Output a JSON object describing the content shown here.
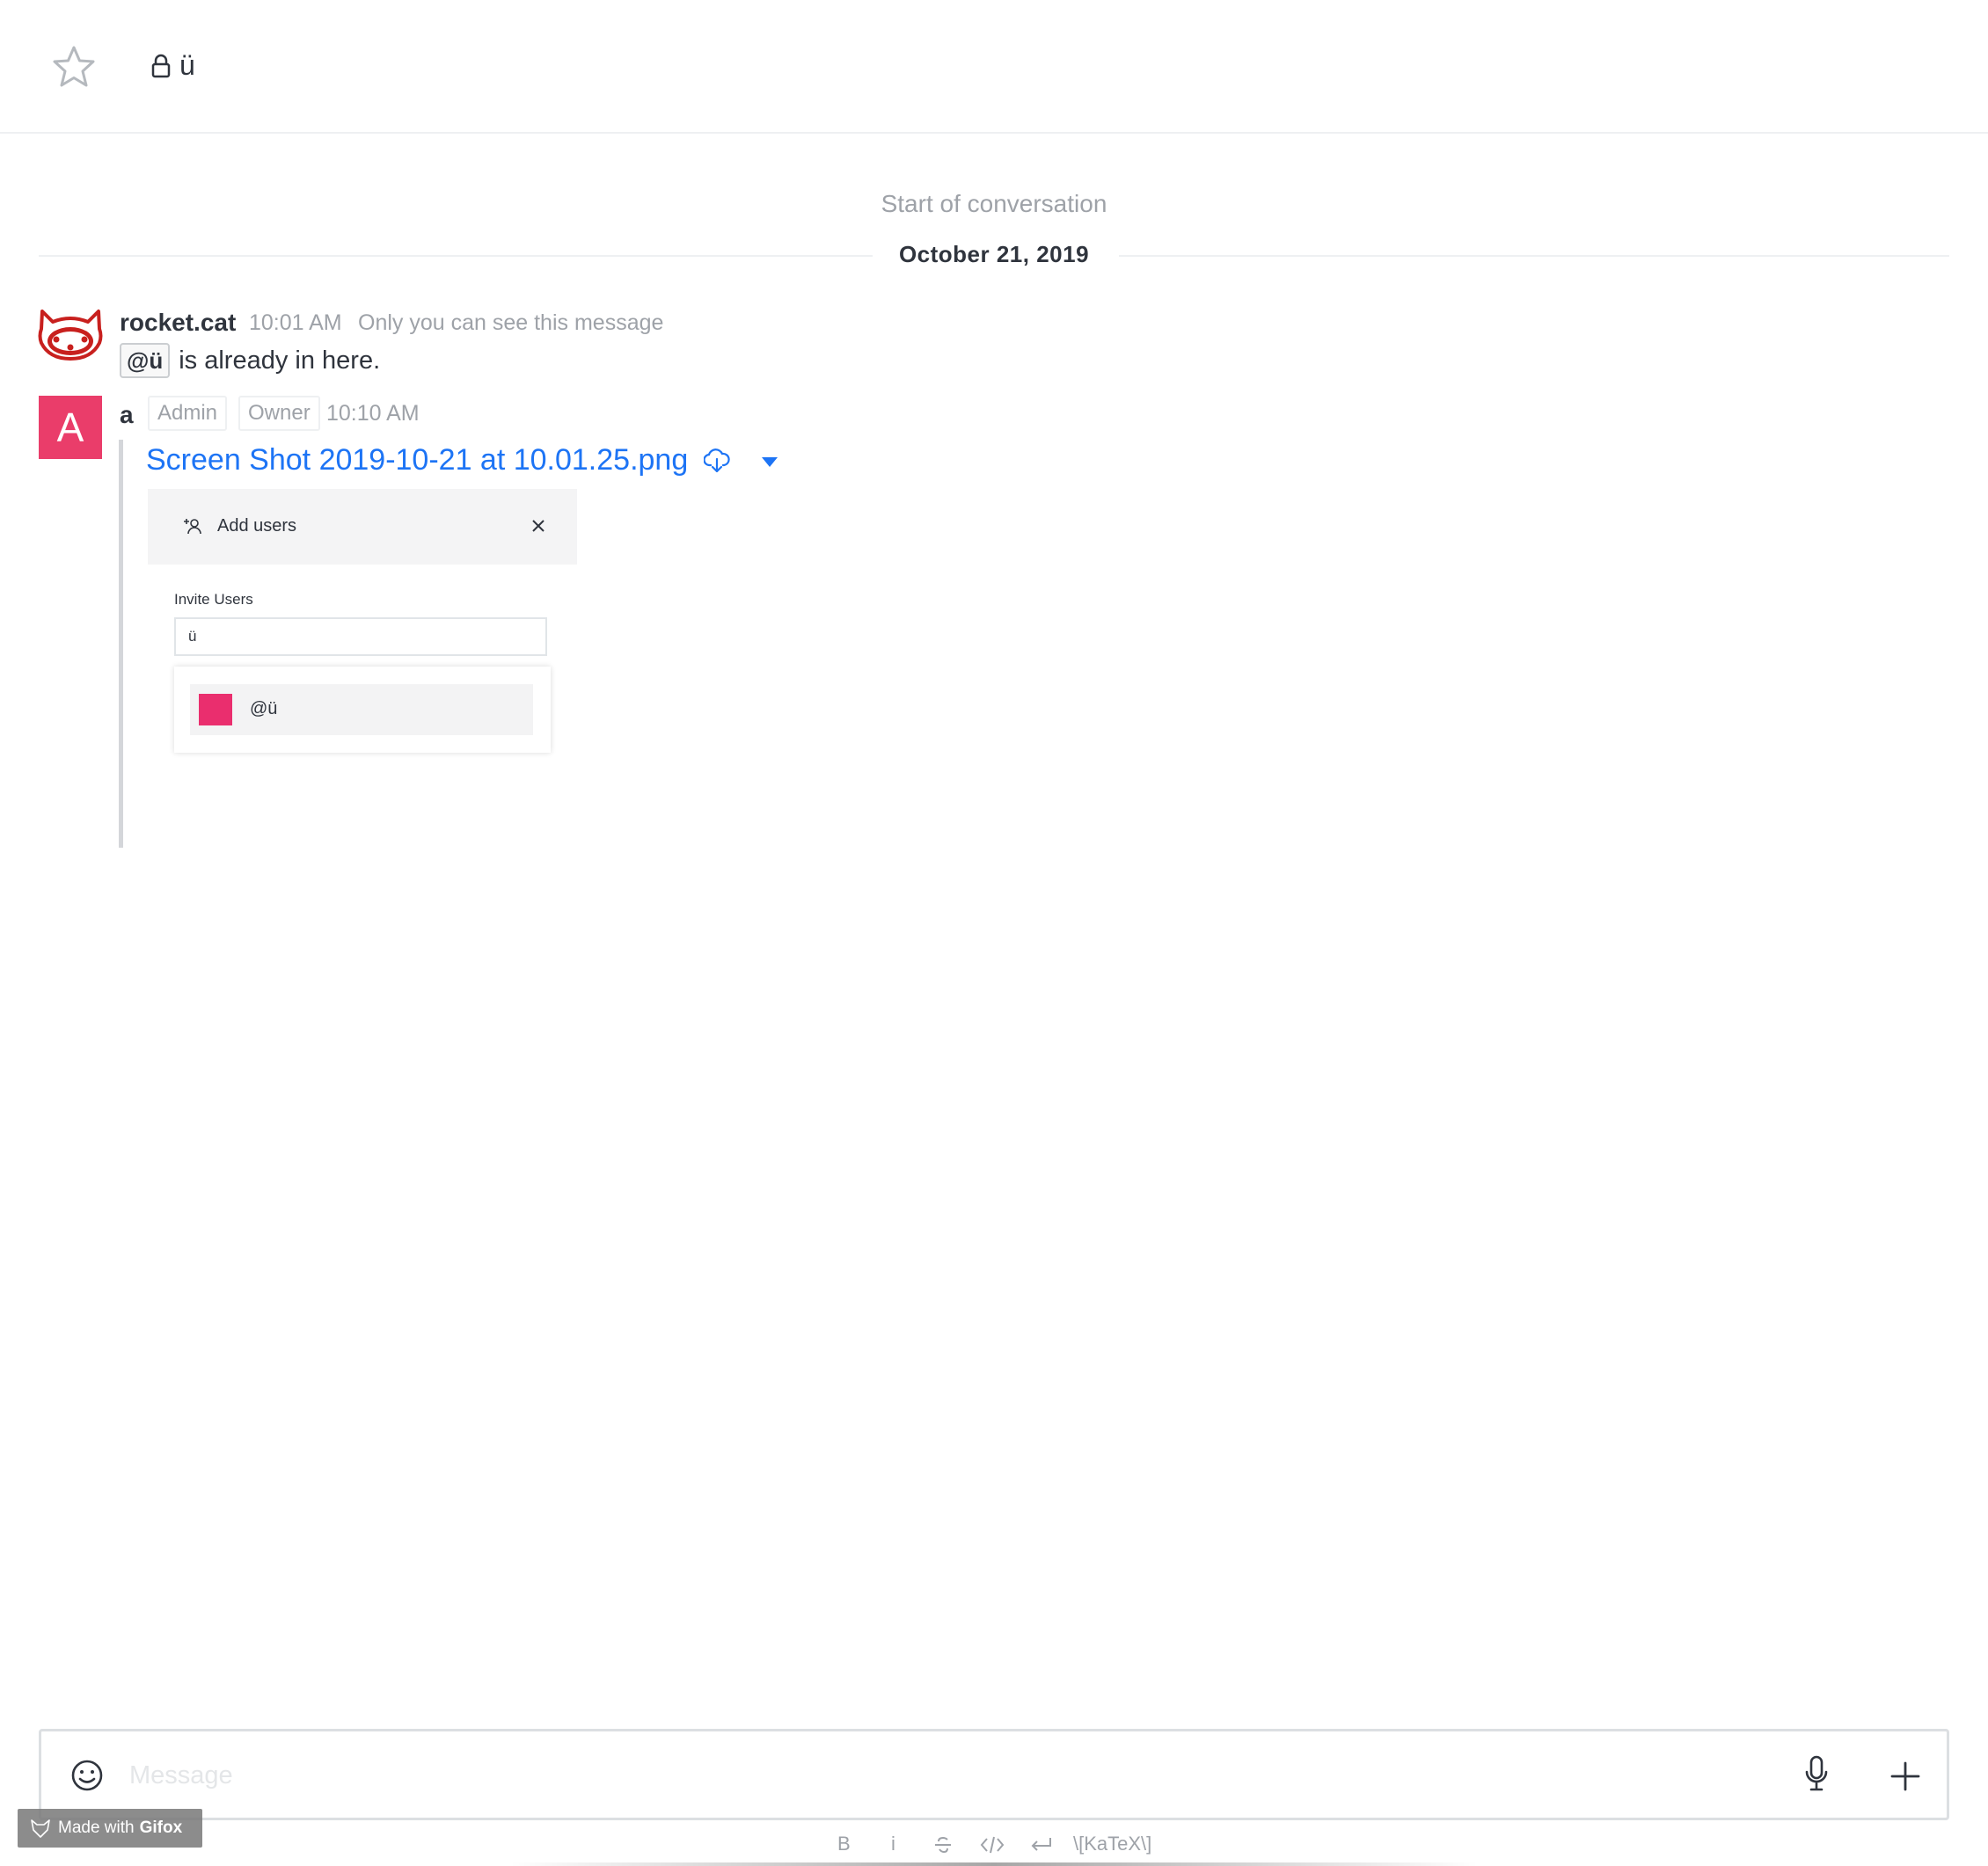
{
  "header": {
    "room_name": "ü"
  },
  "conversation": {
    "start_text": "Start of conversation",
    "date": "October 21, 2019"
  },
  "messages": [
    {
      "user": "rocket.cat",
      "time": "10:01 AM",
      "note": "Only you can see this message",
      "mention": "@ü",
      "text": "is already in here."
    },
    {
      "avatar_letter": "A",
      "user": "a",
      "roles": [
        "Admin",
        "Owner"
      ],
      "time": "10:10 AM",
      "file_name": "Screen Shot 2019-10-21 at 10.01.25.png",
      "preview": {
        "title": "Add users",
        "label": "Invite Users",
        "input_value": "ü",
        "suggestion": "@ü"
      }
    }
  ],
  "composer": {
    "placeholder": "Message",
    "format_bold": "B",
    "format_italic": "i",
    "format_katex": "\\[KaTeX\\]"
  },
  "watermark": {
    "prefix": "Made with",
    "brand": "Gifox"
  },
  "colors": {
    "link": "#1d74f5",
    "avatar": "#ea3d6a",
    "cat": "#c8201e"
  }
}
